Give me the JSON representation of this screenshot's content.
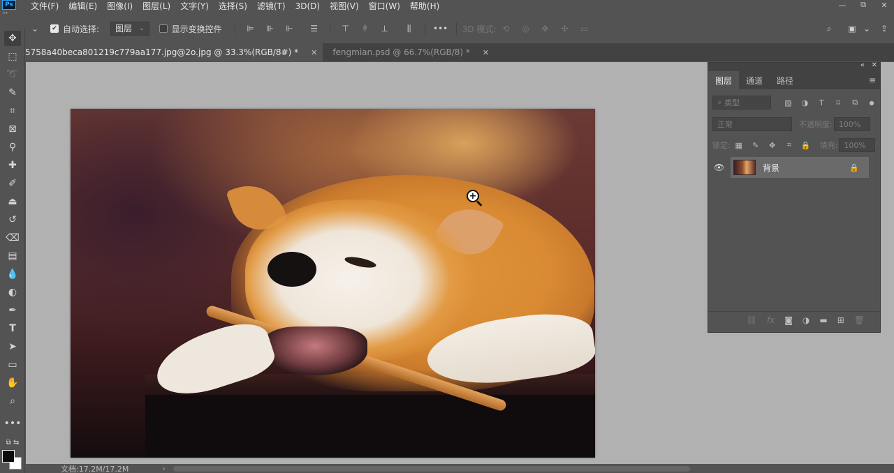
{
  "app": {
    "logo": "Ps"
  },
  "menu": [
    "文件(F)",
    "编辑(E)",
    "图像(I)",
    "图层(L)",
    "文字(Y)",
    "选择(S)",
    "滤镜(T)",
    "3D(D)",
    "视图(V)",
    "窗口(W)",
    "帮助(H)"
  ],
  "window_controls": {
    "minimize": "—",
    "restore": "⧉",
    "close": "✕"
  },
  "options": {
    "auto_select_label": "自动选择:",
    "auto_select_checked": true,
    "auto_select_target": "图层",
    "show_transform_label": "显示变换控件",
    "show_transform_checked": false,
    "more": "•••",
    "mode_3d_label": "3D 模式:"
  },
  "tabs": [
    {
      "label": "5758a40beca801219c779aa177.jpg@2o.jpg @ 33.3%(RGB/8#) *",
      "close": "✕",
      "active": true
    },
    {
      "label": "fengmian.psd @ 66.7%(RGB/8) *",
      "close": "✕",
      "active": false
    }
  ],
  "status": {
    "doc": "文档:17.2M/17.2M",
    "arrow": "›"
  },
  "layers_panel": {
    "tabs": [
      "图层",
      "通道",
      "路径"
    ],
    "filter_placeholder": "类型",
    "blend_mode": "正常",
    "opacity_label": "不透明度:",
    "opacity_value": "100%",
    "lock_label": "锁定:",
    "fill_label": "填充:",
    "fill_value": "100%",
    "layers": [
      {
        "name": "背景",
        "visible": true,
        "locked": true
      }
    ]
  },
  "colors": {
    "ui_bg": "#535353",
    "canvas_bg": "#b1b1b1",
    "tab_bar": "#424242",
    "accent": "#31a8ff"
  }
}
